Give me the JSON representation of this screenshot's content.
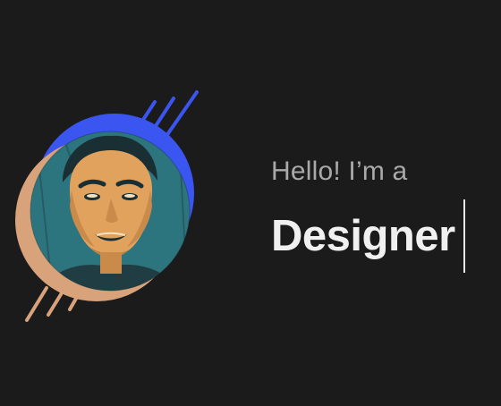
{
  "hero": {
    "greeting": "Hello! I’m a",
    "role": "Designer"
  },
  "avatar": {
    "icon": "profile-photo-icon",
    "ring_back_color": "#3b56f0",
    "ring_front_color": "#d8a27b",
    "photo_bg_color": "#2b6e77",
    "skin_color": "#e0a25c",
    "shadow_color": "#1a2f33"
  },
  "theme": {
    "background": "#1b1b1b",
    "greeting_color": "#a9a9a9",
    "role_color": "#f0f0f0"
  }
}
